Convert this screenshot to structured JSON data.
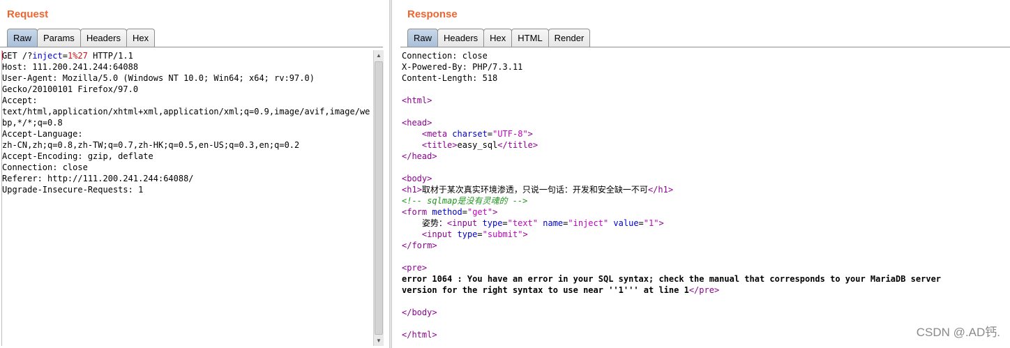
{
  "request": {
    "title": "Request",
    "tabs": [
      "Raw",
      "Params",
      "Headers",
      "Hex"
    ],
    "active_tab": "Raw",
    "line1": {
      "method": "GET /?",
      "param": "inject",
      "eq": "=",
      "value": "1%27",
      "rest": " HTTP/1.1"
    },
    "lines": [
      "Host: 111.200.241.244:64088",
      "User-Agent: Mozilla/5.0 (Windows NT 10.0; Win64; x64; rv:97.0)",
      "Gecko/20100101 Firefox/97.0",
      "Accept:",
      "text/html,application/xhtml+xml,application/xml;q=0.9,image/avif,image/we",
      "bp,*/*;q=0.8",
      "Accept-Language:",
      "zh-CN,zh;q=0.8,zh-TW;q=0.7,zh-HK;q=0.5,en-US;q=0.3,en;q=0.2",
      "Accept-Encoding: gzip, deflate",
      "Connection: close",
      "Referer: http://111.200.241.244:64088/",
      "Upgrade-Insecure-Requests: 1"
    ]
  },
  "response": {
    "title": "Response",
    "tabs": [
      "Raw",
      "Headers",
      "Hex",
      "HTML",
      "Render"
    ],
    "active_tab": "Raw",
    "headers": [
      "Connection: close",
      "X-Powered-By: PHP/7.3.11",
      "Content-Length: 518"
    ],
    "html_tag": "html",
    "head_tag": "head",
    "meta_tag": "meta",
    "meta_attr": "charset",
    "meta_value": "\"UTF-8\"",
    "title_tag": "title",
    "title_text": "easy_sql",
    "body_tag": "body",
    "h1_tag": "h1",
    "h1_text": "取材于某次真实环境渗透，只说一句话：开发和安全缺一不可",
    "comment": "<!-- sqlmap是没有灵魂的 -->",
    "form_tag": "form",
    "form_attr": "method",
    "form_value": "\"get\"",
    "input_label": "姿势：",
    "input_tag": "input",
    "input1_type": "\"text\"",
    "input1_name": "\"inject\"",
    "input1_value": "\"1\"",
    "input2_type": "\"submit\"",
    "pre_tag": "pre",
    "error_line1": "error 1064 : You have an error in your SQL syntax; check the manual that corresponds to your MariaDB server",
    "error_line2": "version for the right syntax to use near ''1''' at line 1"
  },
  "watermark": "CSDN @.AD钙."
}
